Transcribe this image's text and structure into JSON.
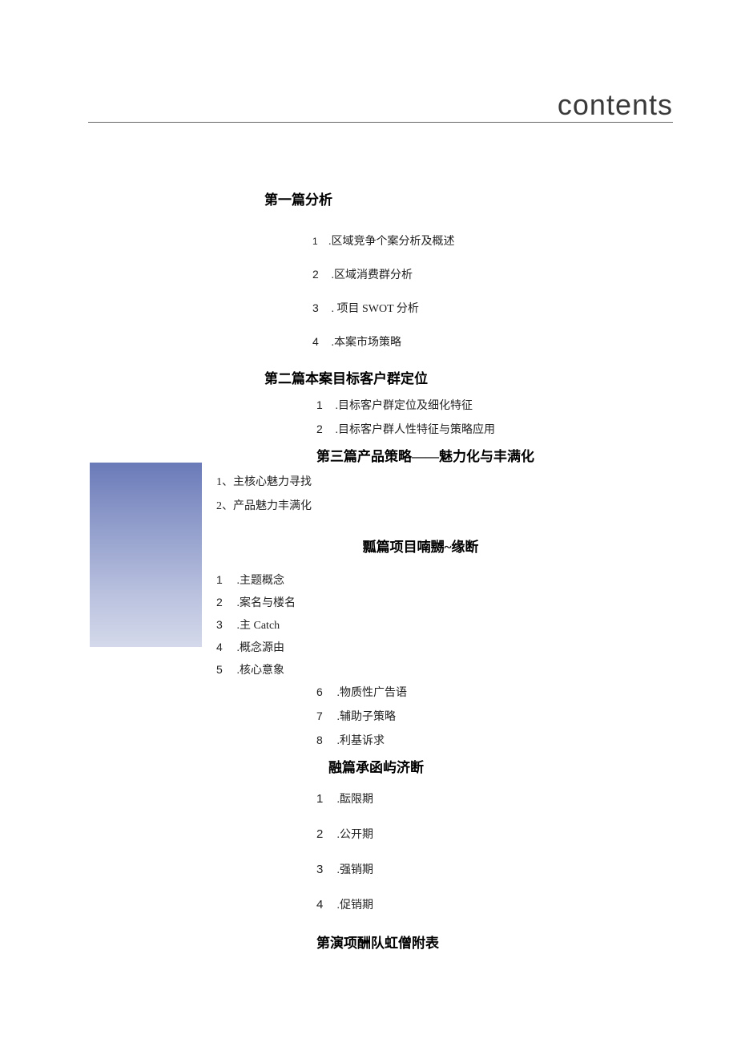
{
  "header": {
    "title": "contents"
  },
  "sections": {
    "s1": {
      "title": "第一篇分析",
      "items": [
        {
          "num": "1",
          "text": ".区域竞争个案分析及概述"
        },
        {
          "num": "2",
          "text": "  .区域消费群分析"
        },
        {
          "num": "3",
          "text": "  . 项目 SWOT 分析"
        },
        {
          "num": "4",
          "text": "  .本案市场策略"
        }
      ]
    },
    "s2": {
      "title": "第二篇本案目标客户群定位",
      "items": [
        {
          "num": "1",
          "text": "  .目标客户群定位及细化特征"
        },
        {
          "num": "2",
          "text": "  .目标客户群人性特征与策略应用"
        }
      ]
    },
    "s3": {
      "title": "第三篇产品策略——魅力化与丰满化",
      "items": [
        {
          "text": "1、主核心魅力寻找"
        },
        {
          "text": "2、产品魅力丰满化"
        }
      ]
    },
    "s4": {
      "title": "瓢篇项目喃嬲~缘断",
      "items_a": [
        {
          "num": "1",
          "text": "  .主题概念"
        },
        {
          "num": "2",
          "text": "  .案名与楼名"
        },
        {
          "num": "3",
          "text": "  .主 Catch"
        },
        {
          "num": "4",
          "text": "  .概念源由"
        },
        {
          "num": "5",
          "text": "  .核心意象"
        }
      ],
      "items_b": [
        {
          "num": "6",
          "text": "  .物质性广告语"
        },
        {
          "num": "7",
          "text": "  .辅助子策略"
        },
        {
          "num": "8",
          "text": "  .利基诉求"
        }
      ]
    },
    "s5": {
      "title": "融篇承函屿济断",
      "items": [
        {
          "num": "1",
          "text": "  .酝限期"
        },
        {
          "num": "2",
          "text": "  .公开期"
        },
        {
          "num": "3",
          "text": "  .强销期"
        },
        {
          "num": "4",
          "text": "  .促销期"
        }
      ]
    },
    "s6": {
      "title": "第演项酬队虹僧附表"
    }
  }
}
